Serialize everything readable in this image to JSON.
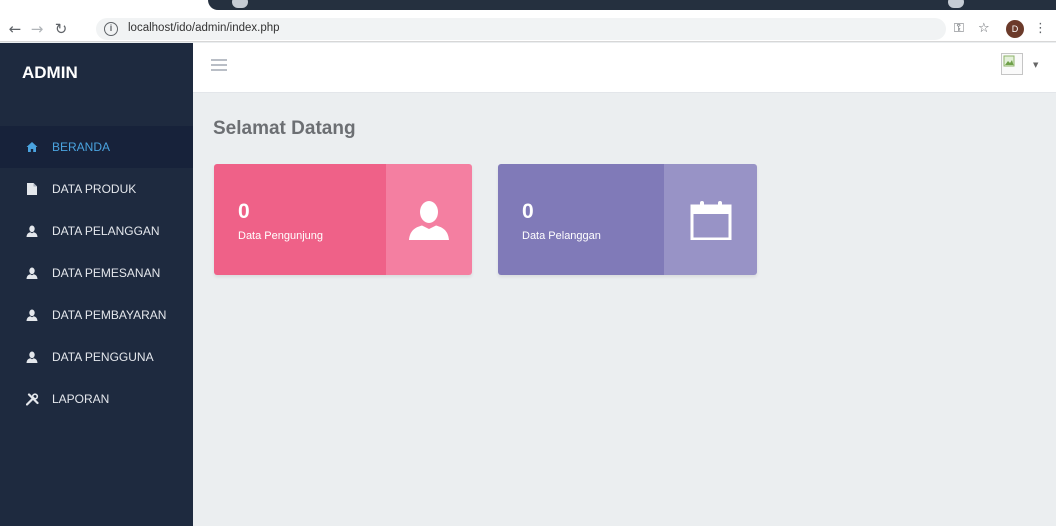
{
  "browser": {
    "url": "localhost/ido/admin/index.php",
    "profile_initial": "D"
  },
  "sidebar": {
    "brand": "ADMIN",
    "items": [
      {
        "label": "BERANDA",
        "icon": "home-icon",
        "active": true
      },
      {
        "label": "DATA PRODUK",
        "icon": "document-icon"
      },
      {
        "label": "DATA PELANGGAN",
        "icon": "user-icon"
      },
      {
        "label": "DATA PEMESANAN",
        "icon": "user-icon"
      },
      {
        "label": "DATA PEMBAYARAN",
        "icon": "user-icon"
      },
      {
        "label": "DATA PENGGUNA",
        "icon": "user-icon"
      },
      {
        "label": "LAPORAN",
        "icon": "tools-icon"
      }
    ]
  },
  "main": {
    "title": "Selamat Datang",
    "cards": [
      {
        "value": "0",
        "label": "Data Pengunjung",
        "icon": "user-icon",
        "color": "#ef6188",
        "side_color": "#f47fa1"
      },
      {
        "value": "0",
        "label": "Data Pelanggan",
        "icon": "calendar-icon",
        "color": "#807ab8",
        "side_color": "#9893c6"
      }
    ]
  },
  "colors": {
    "sidebar_bg": "#1e2a3f",
    "active_item_bg": "#17223a",
    "active_item_text": "#4aa3df",
    "content_bg": "#ebeef0"
  }
}
